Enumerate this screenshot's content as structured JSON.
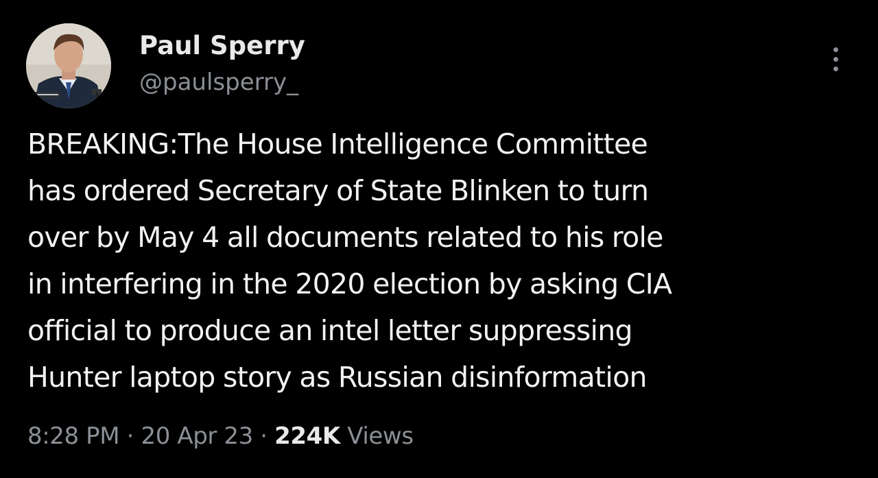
{
  "tweet": {
    "author": {
      "name": "Paul Sperry",
      "handle": "@paulsperry_"
    },
    "text_lines": [
      "BREAKING:The House Intelligence Committee",
      "has ordered Secretary of State Blinken to turn",
      "over by May 4 all documents related to his role",
      "in interfering in the 2020 election by asking CIA",
      "official to produce an intel letter suppressing",
      "Hunter laptop story as Russian disinformation"
    ],
    "time": "8:28 PM",
    "date": "20 Apr 23",
    "separator": "·",
    "views_count": "224K",
    "views_label": "Views"
  },
  "colors": {
    "background": "#000000",
    "primary_text": "#e7e9ea",
    "secondary_text": "#8b9096"
  },
  "icons": {
    "more": "more-horizontal-icon"
  }
}
